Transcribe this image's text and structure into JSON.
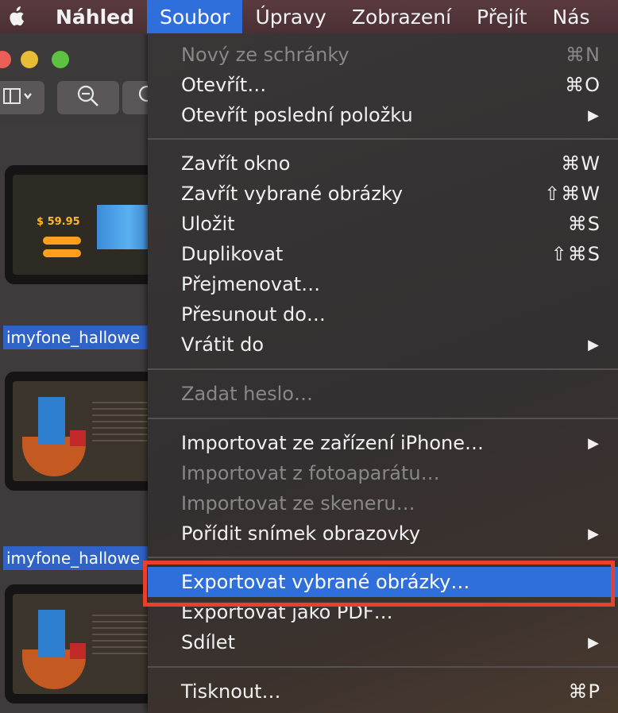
{
  "menubar": {
    "apple": "",
    "app": "Náhled",
    "items": [
      "Soubor",
      "Úpravy",
      "Zobrazení",
      "Přejít",
      "Nás"
    ]
  },
  "window": {
    "toolbar": {
      "sidebar_icon": "sidebar-icon",
      "zoom_out_icon": "zoom-out-icon",
      "zoom_in_icon": "zoom-in-icon"
    },
    "thumbs": [
      {
        "price": "$ 59.95"
      },
      {},
      {}
    ],
    "filenames": [
      "imyfone_hallowe",
      "imyfone_hallowe"
    ]
  },
  "menu": {
    "items": [
      {
        "label": "Nový ze schránky",
        "shortcut": "⌘N",
        "disabled": true
      },
      {
        "label": "Otevřít…",
        "shortcut": "⌘O"
      },
      {
        "label": "Otevřít poslední položku",
        "arrow": "▶"
      },
      {
        "label": "Zavřít okno",
        "shortcut": "⌘W"
      },
      {
        "label": "Zavřít vybrané obrázky",
        "shortcut": "⇧⌘W"
      },
      {
        "label": "Uložit",
        "shortcut": "⌘S"
      },
      {
        "label": "Duplikovat",
        "shortcut": "⇧⌘S"
      },
      {
        "label": "Přejmenovat…"
      },
      {
        "label": "Přesunout do…"
      },
      {
        "label": "Vrátit do",
        "arrow": "▶"
      },
      {
        "label": "Zadat heslo…",
        "disabled": true
      },
      {
        "label": "Importovat ze zařízení iPhone…",
        "arrow": "▶"
      },
      {
        "label": "Importovat z fotoaparátu…",
        "disabled": true
      },
      {
        "label": "Importovat ze skeneru…",
        "disabled": true
      },
      {
        "label": "Pořídit snímek obrazovky",
        "arrow": "▶"
      },
      {
        "label": "Exportovat vybrané obrázky…",
        "highlighted": true
      },
      {
        "label": "Exportovat jako PDF…"
      },
      {
        "label": "Sdílet",
        "arrow": "▶"
      },
      {
        "label": "Tisknout…",
        "shortcut": "⌘P"
      }
    ]
  },
  "colors": {
    "highlight": "#2f6fdc",
    "annotation": "#e8402b"
  }
}
